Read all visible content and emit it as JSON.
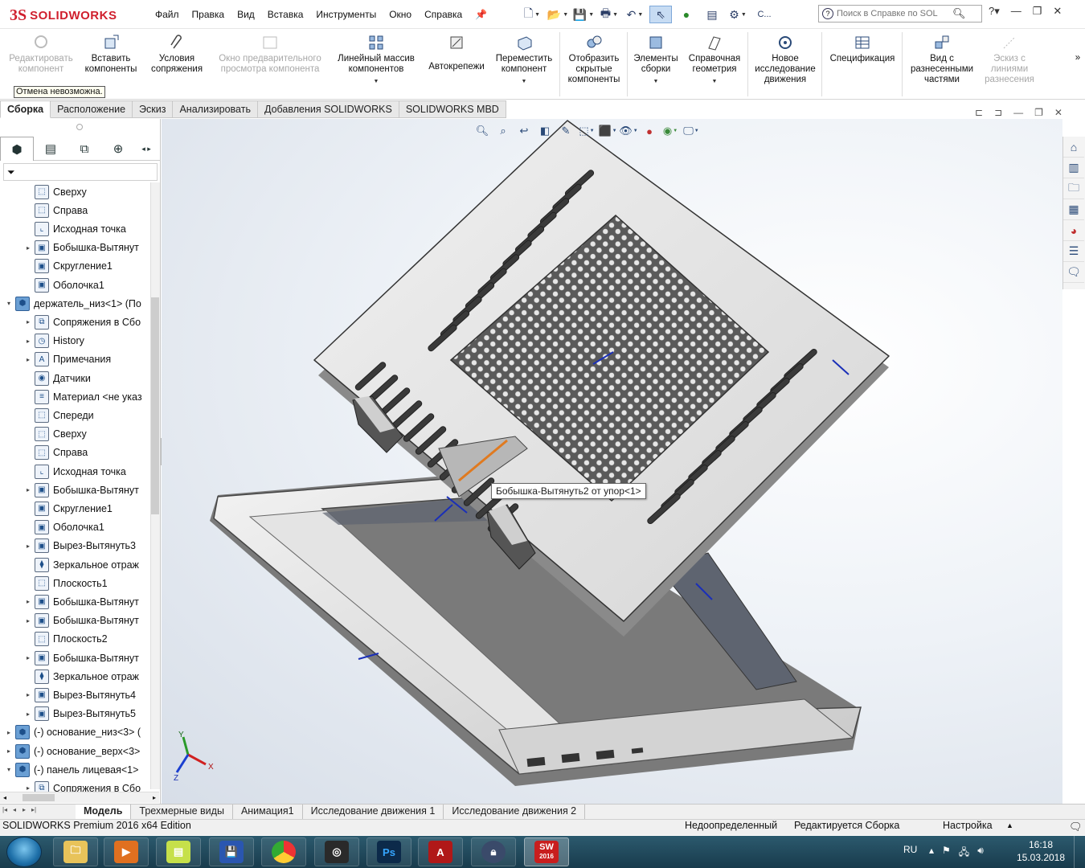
{
  "app": {
    "logo_ds": "3S",
    "logo_name": "SOLIDWORKS",
    "menu": [
      "Файл",
      "Правка",
      "Вид",
      "Вставка",
      "Инструменты",
      "Окно",
      "Справка"
    ],
    "search_placeholder": "Поиск в Справке по SOL",
    "search_prefix": "С..."
  },
  "commands": {
    "edit_component": "Редактировать компонент",
    "insert_components": "Вставить компоненты",
    "mate": "Условия сопряжения",
    "preview_window": "Окно предварительного просмотра компонента",
    "linear_pattern": "Линейный массив компонентов",
    "smart_fasteners": "Автокрепежи",
    "move_component": "Переместить компонент",
    "show_hidden": "Отобразить скрытые компоненты",
    "assembly_features": "Элементы сборки",
    "reference_geometry": "Справочная геометрия",
    "new_motion_study": "Новое исследование движения",
    "bom": "Спецификация",
    "exploded_view": "Вид с разнесенными частями",
    "explode_line_sketch": "Эскиз с линиями разнесения"
  },
  "tooltip_undo": "Отмена невозможна.",
  "command_tabs": [
    "Сборка",
    "Расположение",
    "Эскиз",
    "Анализировать",
    "Добавления SOLIDWORKS",
    "SOLIDWORKS MBD"
  ],
  "tree": [
    {
      "label": "Сверху",
      "indent": 1,
      "exp": "",
      "icon": "plane"
    },
    {
      "label": "Справа",
      "indent": 1,
      "exp": "",
      "icon": "plane"
    },
    {
      "label": "Исходная точка",
      "indent": 1,
      "exp": "",
      "icon": "origin"
    },
    {
      "label": "Бобышка-Вытянут",
      "indent": 1,
      "exp": "▸",
      "icon": "feature"
    },
    {
      "label": "Скругление1",
      "indent": 1,
      "exp": "",
      "icon": "feature"
    },
    {
      "label": "Оболочка1",
      "indent": 1,
      "exp": "",
      "icon": "feature"
    },
    {
      "label": "держатель_низ<1> (По",
      "indent": 0,
      "exp": "▾",
      "icon": "part"
    },
    {
      "label": "Сопряжения в Сбо",
      "indent": 1,
      "exp": "▸",
      "icon": "mates"
    },
    {
      "label": "History",
      "indent": 1,
      "exp": "▸",
      "icon": "history"
    },
    {
      "label": "Примечания",
      "indent": 1,
      "exp": "▸",
      "icon": "annotation"
    },
    {
      "label": "Датчики",
      "indent": 1,
      "exp": "",
      "icon": "sensor"
    },
    {
      "label": "Материал <не указ",
      "indent": 1,
      "exp": "",
      "icon": "material"
    },
    {
      "label": "Спереди",
      "indent": 1,
      "exp": "",
      "icon": "plane"
    },
    {
      "label": "Сверху",
      "indent": 1,
      "exp": "",
      "icon": "plane"
    },
    {
      "label": "Справа",
      "indent": 1,
      "exp": "",
      "icon": "plane"
    },
    {
      "label": "Исходная точка",
      "indent": 1,
      "exp": "",
      "icon": "origin"
    },
    {
      "label": "Бобышка-Вытянут",
      "indent": 1,
      "exp": "▸",
      "icon": "feature"
    },
    {
      "label": "Скругление1",
      "indent": 1,
      "exp": "",
      "icon": "feature"
    },
    {
      "label": "Оболочка1",
      "indent": 1,
      "exp": "",
      "icon": "feature"
    },
    {
      "label": "Вырез-Вытянуть3",
      "indent": 1,
      "exp": "▸",
      "icon": "feature"
    },
    {
      "label": "Зеркальное отраж",
      "indent": 1,
      "exp": "",
      "icon": "mirror"
    },
    {
      "label": "Плоскость1",
      "indent": 1,
      "exp": "",
      "icon": "plane"
    },
    {
      "label": "Бобышка-Вытянут",
      "indent": 1,
      "exp": "▸",
      "icon": "feature"
    },
    {
      "label": "Бобышка-Вытянут",
      "indent": 1,
      "exp": "▸",
      "icon": "feature"
    },
    {
      "label": "Плоскость2",
      "indent": 1,
      "exp": "",
      "icon": "plane"
    },
    {
      "label": "Бобышка-Вытянут",
      "indent": 1,
      "exp": "▸",
      "icon": "feature"
    },
    {
      "label": "Зеркальное отраж",
      "indent": 1,
      "exp": "",
      "icon": "mirror"
    },
    {
      "label": "Вырез-Вытянуть4",
      "indent": 1,
      "exp": "▸",
      "icon": "feature"
    },
    {
      "label": "Вырез-Вытянуть5",
      "indent": 1,
      "exp": "▸",
      "icon": "feature"
    },
    {
      "label": "(-) основание_низ<3> (",
      "indent": 0,
      "exp": "▸",
      "icon": "part"
    },
    {
      "label": "(-) основание_верх<3>",
      "indent": 0,
      "exp": "▸",
      "icon": "part"
    },
    {
      "label": "(-) панель лицевая<1>",
      "indent": 0,
      "exp": "▾",
      "icon": "part"
    },
    {
      "label": "Сопряжения в Сбо",
      "indent": 1,
      "exp": "▸",
      "icon": "mates"
    }
  ],
  "viewport_tooltip": "Бобышка-Вытянуть2 от упор<1>",
  "triad": {
    "x": "X",
    "y": "Y",
    "z": "Z"
  },
  "bottom_tabs": [
    "Модель",
    "Трехмерные виды",
    "Анимация1",
    "Исследование движения 1",
    "Исследование движения 2"
  ],
  "status": {
    "edition": "SOLIDWORKS Premium 2016 x64 Edition",
    "definition": "Недоопределенный",
    "editing": "Редактируется Сборка",
    "custom": "Настройка"
  },
  "taskbar": {
    "lang": "RU",
    "time": "16:18",
    "date": "15.03.2018",
    "sw_badge": "2016",
    "ps": "Ps"
  }
}
